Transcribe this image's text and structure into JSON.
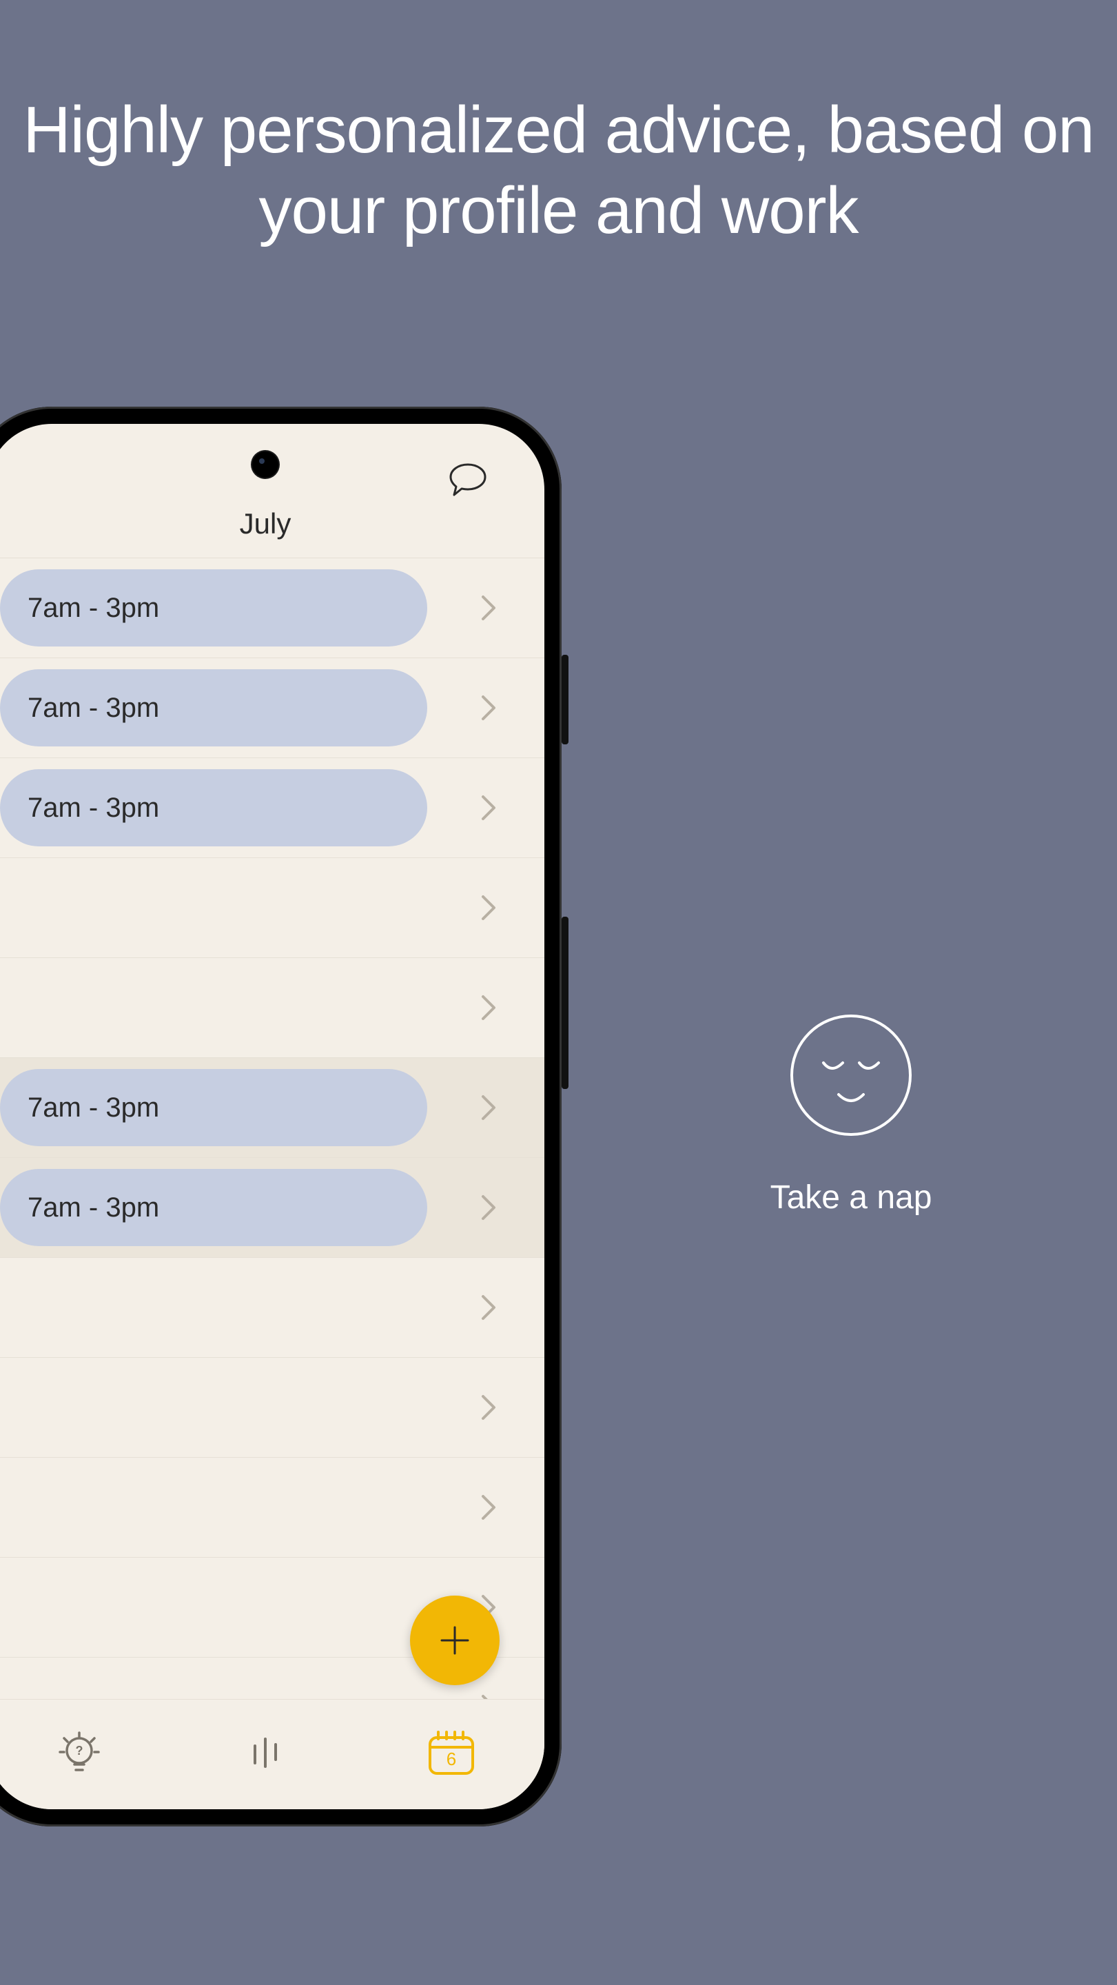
{
  "headline": "Highly personalized advice, based on your profile and work",
  "phone": {
    "month": "July",
    "rows": [
      {
        "label": "7am - 3pm",
        "highlight": false,
        "hasPill": true
      },
      {
        "label": "7am - 3pm",
        "highlight": false,
        "hasPill": true
      },
      {
        "label": "7am - 3pm",
        "highlight": false,
        "hasPill": true
      },
      {
        "label": "",
        "highlight": false,
        "hasPill": false
      },
      {
        "label": "",
        "highlight": false,
        "hasPill": false
      },
      {
        "label": "7am - 3pm",
        "highlight": true,
        "hasPill": true
      },
      {
        "label": "7am - 3pm",
        "highlight": true,
        "hasPill": true
      },
      {
        "label": "",
        "highlight": false,
        "hasPill": false
      },
      {
        "label": "",
        "highlight": false,
        "hasPill": false
      },
      {
        "label": "",
        "highlight": false,
        "hasPill": false
      },
      {
        "label": "",
        "highlight": false,
        "hasPill": false
      },
      {
        "label": "",
        "highlight": false,
        "hasPill": false
      }
    ],
    "calendar_badge": "6"
  },
  "side": {
    "nap_label": "Take a nap"
  }
}
